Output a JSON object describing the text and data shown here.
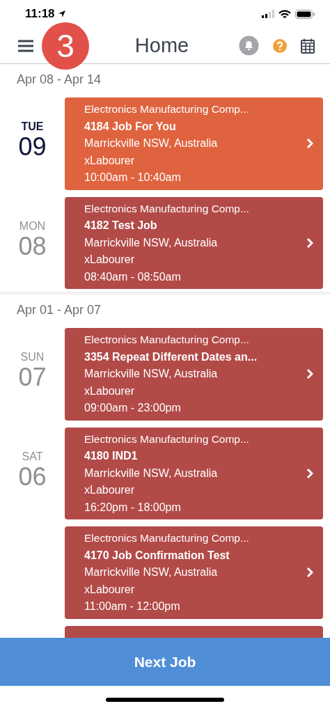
{
  "status_bar": {
    "time": "11:18"
  },
  "header": {
    "title": "Home",
    "step_badge": "3"
  },
  "weeks": [
    {
      "label": "Apr 08 - Apr 14",
      "days": [
        {
          "weekday": "TUE",
          "date": "09",
          "selected": true,
          "jobs": [
            {
              "kind": "full",
              "color": "#e0633f",
              "company": "Electronics Manufacturing Comp...",
              "title": "4184 Job For You",
              "location": "Marrickville NSW, Australia",
              "role": "xLabourer",
              "time": "10:00am - 10:40am"
            }
          ]
        },
        {
          "weekday": "MON",
          "date": "08",
          "selected": false,
          "jobs": [
            {
              "kind": "full",
              "color": "#b24a48",
              "company": "Electronics Manufacturing Comp...",
              "title": "4182 Test Job",
              "location": "Marrickville NSW, Australia",
              "role": "xLabourer",
              "time": "08:40am - 08:50am"
            }
          ]
        }
      ]
    },
    {
      "label": "Apr 01 - Apr 07",
      "days": [
        {
          "weekday": "SUN",
          "date": "07",
          "selected": false,
          "jobs": [
            {
              "kind": "full",
              "color": "#b24a48",
              "company": "Electronics Manufacturing Comp...",
              "title": "3354 Repeat Different Dates an...",
              "location": "Marrickville NSW, Australia",
              "role": "xLabourer",
              "time": "09:00am - 23:00pm"
            }
          ]
        },
        {
          "weekday": "SAT",
          "date": "06",
          "selected": false,
          "jobs": [
            {
              "kind": "full",
              "color": "#b24a48",
              "company": "Electronics Manufacturing Comp...",
              "title": "4180 IND1",
              "location": "Marrickville NSW, Australia",
              "role": "xLabourer",
              "time": "16:20pm - 18:00pm"
            },
            {
              "kind": "full",
              "color": "#b24a48",
              "company": "Electronics Manufacturing Comp...",
              "title": "4170 Job Confirmation Test",
              "location": "Marrickville NSW, Australia",
              "role": "xLabourer",
              "time": "11:00am - 12:00pm"
            },
            {
              "kind": "hidden",
              "color": "#b24a48"
            }
          ]
        }
      ]
    }
  ],
  "next_button": {
    "label": "Next Job"
  }
}
